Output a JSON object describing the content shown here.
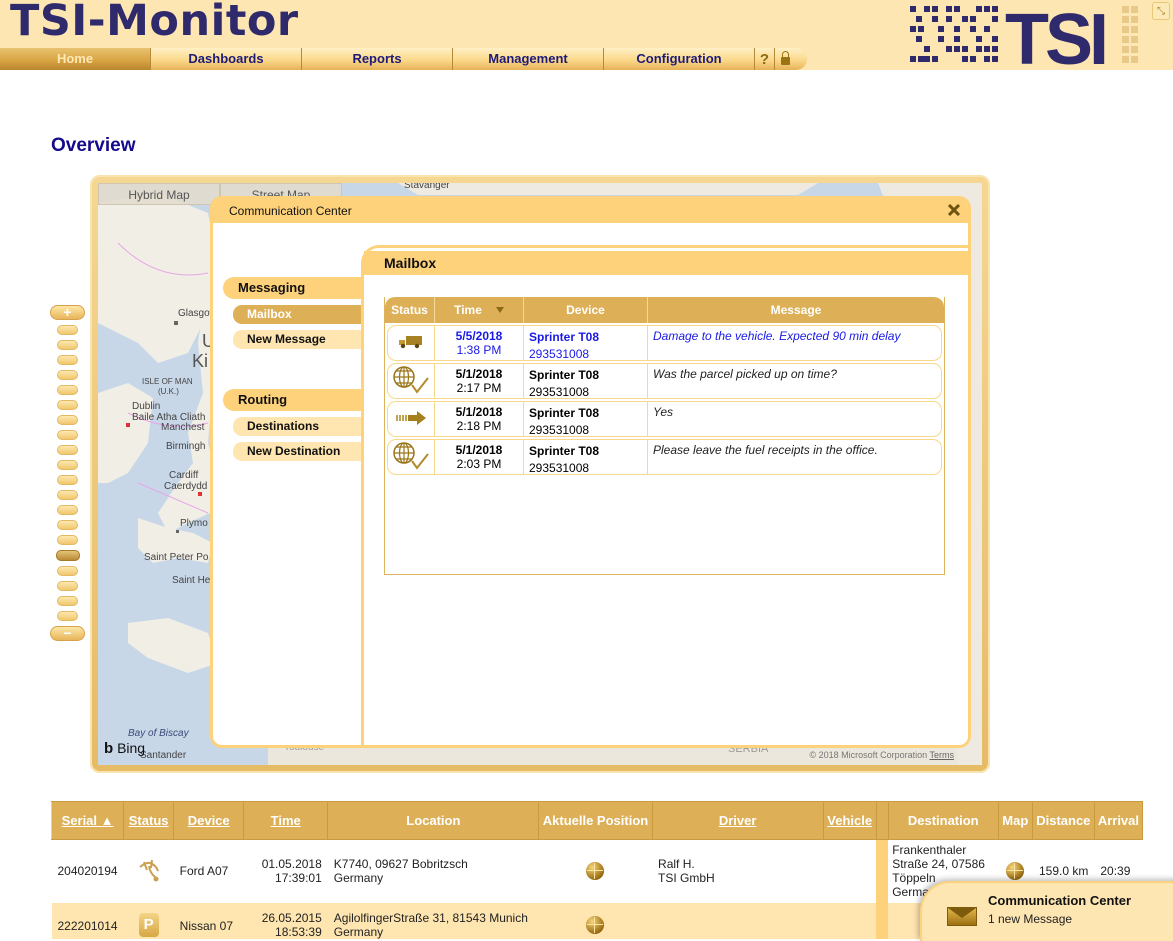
{
  "header": {
    "app_title": "TSI-Monitor",
    "nav": [
      {
        "label": "Home",
        "active": true
      },
      {
        "label": "Dashboards"
      },
      {
        "label": "Reports"
      },
      {
        "label": "Management"
      },
      {
        "label": "Configuration"
      }
    ],
    "help_label": "?",
    "logo_text": "TSI"
  },
  "page_title": "Overview",
  "map": {
    "tabs": [
      "Hybrid Map",
      "Street Map"
    ],
    "labels": {
      "stavanger": "Stavanger",
      "glasgow": "Glasgow",
      "uk_1": "U",
      "uk_2": "Ki",
      "isle_of_man": "ISLE OF MAN",
      "uk_abbr": "(U.K.)",
      "dublin": "Dublin",
      "baile": "Baile Atha Cliath",
      "manchester": "Manchest",
      "birmingham": "Birmingh",
      "cardiff": "Cardiff",
      "caerdydd": "Caerdydd",
      "plymouth": "Plymo",
      "saint_peter": "Saint Peter Po",
      "saint_helier": "Saint He",
      "bay_of_biscay": "Bay of Biscay",
      "santander": "Santander",
      "toulouse": "Toulouse",
      "serbia": "SERBIA"
    },
    "bing": "Bing",
    "copyright": "© 2018 Microsoft Corporation",
    "terms": "Terms"
  },
  "zoom_slider": {
    "levels": 20,
    "current_level": 16
  },
  "comm_center": {
    "title": "Communication Center",
    "sidebar": {
      "sections": [
        {
          "label": "Messaging",
          "items": [
            {
              "label": "Mailbox",
              "active": true
            },
            {
              "label": "New Message"
            }
          ]
        },
        {
          "label": "Routing",
          "items": [
            {
              "label": "Destinations"
            },
            {
              "label": "New Destination"
            }
          ]
        }
      ]
    },
    "mailbox": {
      "title": "Mailbox",
      "columns": [
        "Status",
        "Time",
        "Device",
        "Message"
      ],
      "rows": [
        {
          "status_icon": "truck-icon",
          "date": "5/5/2018",
          "time": "1:38 PM",
          "device": "Sprinter T08",
          "device_id": "293531008",
          "message": "Damage to the vehicle. Expected 90 min delay",
          "unread": true
        },
        {
          "status_icon": "globe-check-icon",
          "date": "5/1/2018",
          "time": "2:17 PM",
          "device": "Sprinter T08",
          "device_id": "293531008",
          "message": "Was the parcel picked up on time?",
          "unread": false
        },
        {
          "status_icon": "arrow-right-icon",
          "date": "5/1/2018",
          "time": "2:18 PM",
          "device": "Sprinter T08",
          "device_id": "293531008",
          "message": "Yes",
          "unread": false
        },
        {
          "status_icon": "globe-check-icon",
          "date": "5/1/2018",
          "time": "2:03 PM",
          "device": "Sprinter T08",
          "device_id": "293531008",
          "message": "Please leave the fuel receipts in the office.",
          "unread": false
        }
      ]
    }
  },
  "grid": {
    "columns": [
      "Serial ▲",
      "Status",
      "Device",
      "Time",
      "Location",
      "Aktuelle Position",
      "Driver",
      "Vehicle",
      "",
      "Destination",
      "Map",
      "Distance",
      "Arrival"
    ],
    "rows": [
      {
        "serial": "204020194",
        "status_icon": "satellite-icon",
        "device": "Ford A07",
        "date": "01.05.2018",
        "time": "17:39:01",
        "location_1": "K7740, 09627 Bobritzsch",
        "location_2": "Germany",
        "driver_1": "Ralf H.",
        "driver_2": "TSI GmbH",
        "vehicle": "",
        "destination_1": "Frankenthaler",
        "destination_2": "Straße 24, 07586",
        "destination_3": "Töppeln",
        "destination_4": "Germany",
        "distance": "159.0 km",
        "arrival": "20:39"
      },
      {
        "serial": "222201014",
        "status_icon": "parking-icon",
        "status_text": "P",
        "device": "Nissan 07",
        "date": "26.05.2015",
        "time": "18:53:39",
        "location_1": "AgilolfingerStraße 31, 81543 Munich",
        "location_2": "Germany",
        "driver_1": "",
        "driver_2": "",
        "vehicle": "",
        "destination_1": "",
        "distance": "",
        "arrival": ""
      }
    ]
  },
  "notification": {
    "title": "Communication Center",
    "subtitle": "1 new Message"
  },
  "colors": {
    "header_bg": "#fee6b3",
    "title_navy": "#2e2a6b",
    "accent_gold": "#ddb057",
    "panel_yellow": "#fed27a",
    "link_blue": "#1a1ae6"
  }
}
